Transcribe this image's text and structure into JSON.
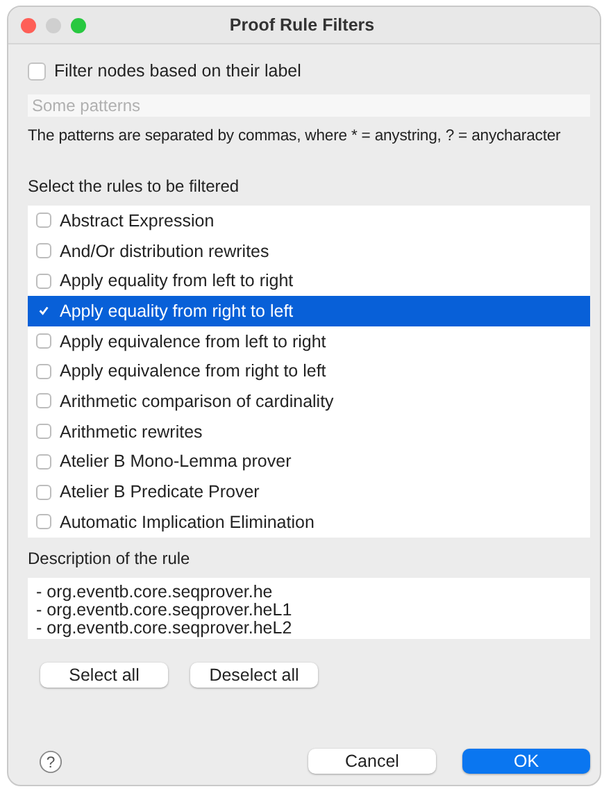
{
  "window": {
    "title": "Proof Rule Filters"
  },
  "label_filter": {
    "label": "Filter nodes based on their label",
    "checked": false
  },
  "patterns_field": {
    "placeholder": "Some patterns"
  },
  "patterns_hint": "The patterns are separated by commas, where * = anystring, ? = anycharacter",
  "rules_heading": "Select the rules to be filtered",
  "rules": [
    {
      "label": "Abstract Expression",
      "checked": false,
      "selected": false
    },
    {
      "label": "And/Or distribution rewrites",
      "checked": false,
      "selected": false
    },
    {
      "label": "Apply equality from left to right",
      "checked": false,
      "selected": false
    },
    {
      "label": "Apply equality from right to left",
      "checked": true,
      "selected": true
    },
    {
      "label": "Apply equivalence from left to right",
      "checked": false,
      "selected": false
    },
    {
      "label": "Apply equivalence from right to left",
      "checked": false,
      "selected": false
    },
    {
      "label": "Arithmetic comparison of cardinality",
      "checked": false,
      "selected": false
    },
    {
      "label": "Arithmetic rewrites",
      "checked": false,
      "selected": false
    },
    {
      "label": "Atelier B Mono-Lemma prover",
      "checked": false,
      "selected": false
    },
    {
      "label": "Atelier B Predicate Prover",
      "checked": false,
      "selected": false
    },
    {
      "label": "Automatic Implication Elimination",
      "checked": false,
      "selected": false
    }
  ],
  "description_heading": "Description of the rule",
  "description_lines": [
    "- org.eventb.core.seqprover.he",
    "- org.eventb.core.seqprover.heL1",
    "- org.eventb.core.seqprover.heL2"
  ],
  "selection_buttons": [
    "Select all",
    "Deselect all"
  ],
  "help": "?",
  "dialog_buttons": [
    {
      "label": "Cancel",
      "kind": "secondary"
    },
    {
      "label": "OK",
      "kind": "primary"
    }
  ]
}
